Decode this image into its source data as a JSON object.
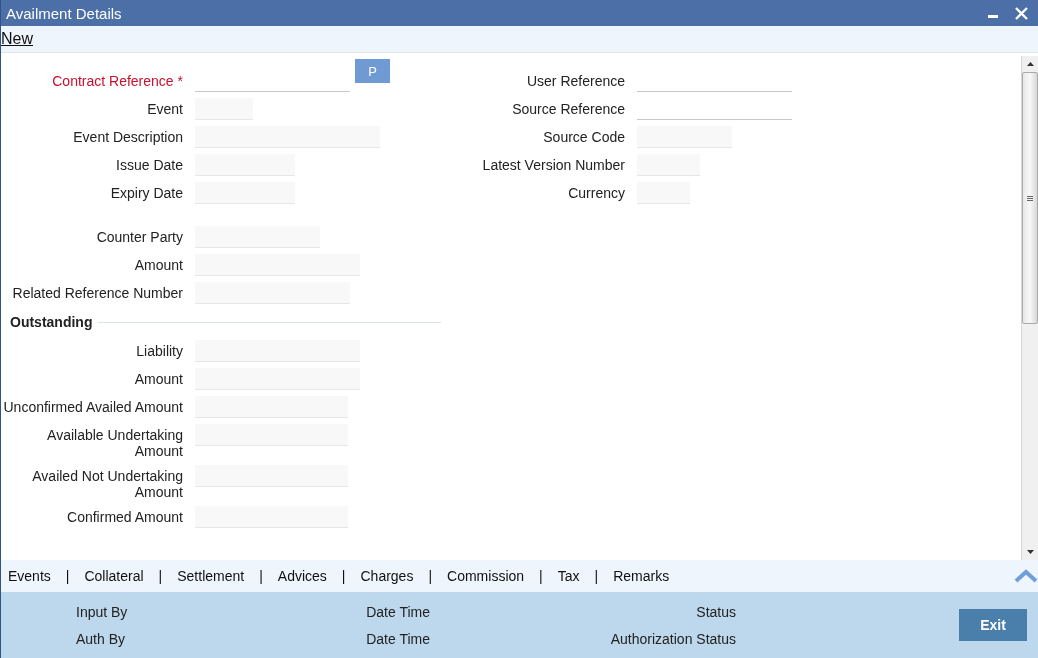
{
  "window": {
    "title": "Availment Details"
  },
  "toolbar": {
    "new_link": "New"
  },
  "form": {
    "left_groups": [
      [
        {
          "label": "Contract Reference",
          "required": true,
          "required_mark": "*",
          "kind": "underline",
          "lookup_button": "P"
        },
        {
          "label": "Event",
          "required": false,
          "kind": "box"
        },
        {
          "label": "Event Description",
          "required": false,
          "kind": "box"
        },
        {
          "label": "Issue Date",
          "required": false,
          "kind": "box"
        },
        {
          "label": "Expiry Date",
          "required": false,
          "kind": "box"
        }
      ],
      [
        {
          "label": "Counter Party",
          "required": false,
          "kind": "box"
        },
        {
          "label": "Amount",
          "required": false,
          "kind": "box"
        },
        {
          "label": "Related Reference Number",
          "required": false,
          "kind": "box"
        }
      ]
    ],
    "outstanding": {
      "heading": "Outstanding",
      "fields": [
        {
          "label": "Liability",
          "required": false,
          "kind": "box"
        },
        {
          "label": "Amount",
          "required": false,
          "kind": "box"
        },
        {
          "label": "Unconfirmed Availed Amount",
          "required": false,
          "kind": "box"
        },
        {
          "label": "Available Undertaking Amount",
          "required": false,
          "kind": "box"
        },
        {
          "label": "Availed Not Undertaking Amount",
          "required": false,
          "kind": "box"
        },
        {
          "label": "Confirmed Amount",
          "required": false,
          "kind": "box"
        }
      ]
    },
    "right_fields": [
      {
        "label": "User Reference",
        "required": false,
        "kind": "underline"
      },
      {
        "label": "Source Reference",
        "required": false,
        "kind": "underline"
      },
      {
        "label": "Source Code",
        "required": false,
        "kind": "box"
      },
      {
        "label": "Latest Version Number",
        "required": false,
        "kind": "box"
      },
      {
        "label": "Currency",
        "required": false,
        "kind": "box"
      }
    ]
  },
  "tabs": {
    "separator": "|",
    "items": [
      "Events",
      "Collateral",
      "Settlement",
      "Advices",
      "Charges",
      "Commission",
      "Tax",
      "Remarks"
    ]
  },
  "audit": {
    "rows": [
      [
        "Input By",
        "Date Time",
        "Status"
      ],
      [
        "Auth By",
        "Date Time",
        "Authorization Status"
      ]
    ]
  },
  "exit_button": "Exit"
}
